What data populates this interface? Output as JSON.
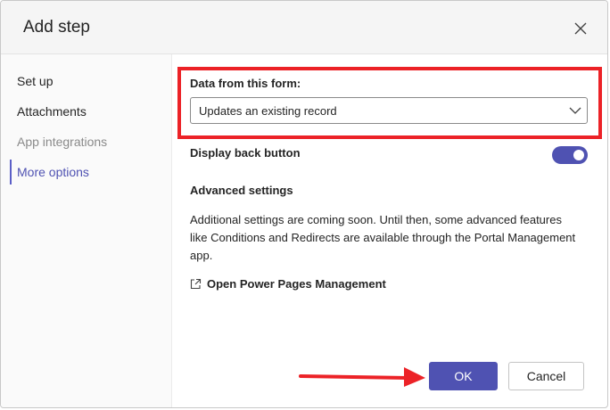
{
  "dialog": {
    "title": "Add step"
  },
  "nav": {
    "items": [
      {
        "label": "Set up",
        "state": "normal"
      },
      {
        "label": "Attachments",
        "state": "normal"
      },
      {
        "label": "App integrations",
        "state": "disabled"
      },
      {
        "label": "More options",
        "state": "active"
      }
    ]
  },
  "form": {
    "data_label": "Data from this form:",
    "data_value": "Updates an existing record",
    "toggle_label": "Display back button",
    "toggle_on": true,
    "advanced_title": "Advanced settings",
    "advanced_desc": "Additional settings are coming soon. Until then, some advanced features like Conditions and Redirects are available through the Portal Management app.",
    "link_label": "Open Power Pages Management"
  },
  "footer": {
    "ok_label": "OK",
    "cancel_label": "Cancel"
  },
  "colors": {
    "accent": "#4f52b2",
    "highlight": "#ec2227"
  },
  "icons": {
    "close": "close-icon",
    "dropdown": "chevron-down-icon",
    "external": "open-external-icon",
    "annotation": "red-arrow-icon"
  }
}
